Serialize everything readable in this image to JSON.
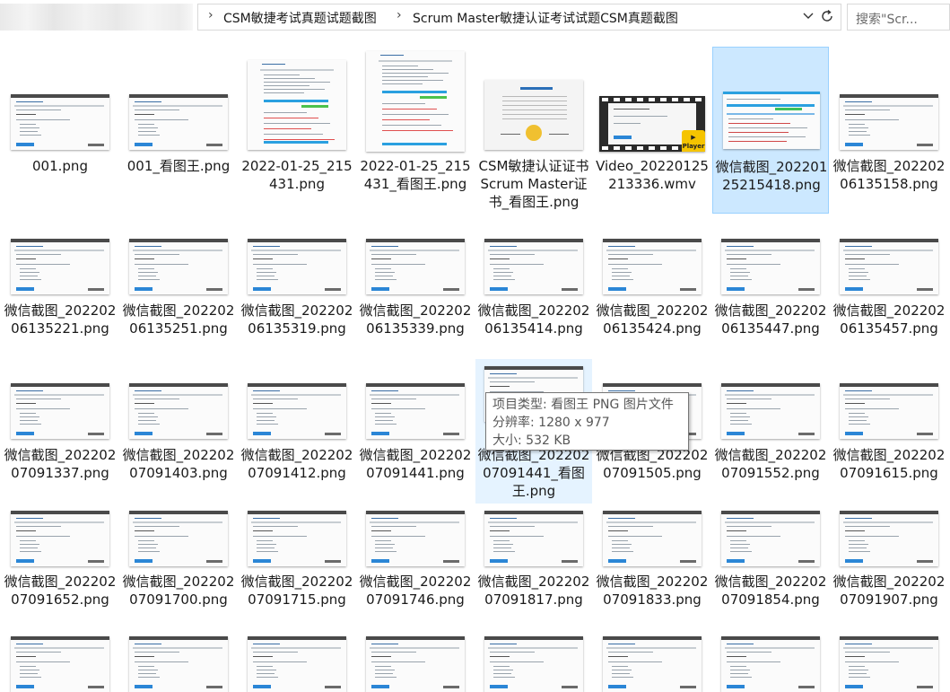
{
  "address_bar": {
    "breadcrumbs": [
      "CSM敏捷考试真题试题截图",
      "Scrum Master敏捷认证考试试题CSM真题截图"
    ]
  },
  "search": {
    "placeholder": "搜索\"Scr..."
  },
  "files": [
    {
      "name": "001.png",
      "kind": "screen"
    },
    {
      "name": "001_看图王.png",
      "kind": "screen"
    },
    {
      "name": "2022-01-25_215431.png",
      "kind": "doc"
    },
    {
      "name": "2022-01-25_215431_看图王.png",
      "kind": "doc"
    },
    {
      "name": "CSM敏捷认证证书 Scrum Master证书_看图王.png",
      "kind": "cert"
    },
    {
      "name": "Video_20220125213336.wmv",
      "kind": "video"
    },
    {
      "name": "微信截图_20220125215418.png",
      "kind": "wide",
      "selected": true
    },
    {
      "name": "微信截图_20220206135158.png",
      "kind": "screen"
    },
    {
      "name": "微信截图_20220206135221.png",
      "kind": "screen"
    },
    {
      "name": "微信截图_20220206135251.png",
      "kind": "screen"
    },
    {
      "name": "微信截图_20220206135319.png",
      "kind": "screen"
    },
    {
      "name": "微信截图_20220206135339.png",
      "kind": "screen"
    },
    {
      "name": "微信截图_20220206135414.png",
      "kind": "screen"
    },
    {
      "name": "微信截图_20220206135424.png",
      "kind": "screen"
    },
    {
      "name": "微信截图_20220206135447.png",
      "kind": "screen"
    },
    {
      "name": "微信截图_20220206135457.png",
      "kind": "screen"
    },
    {
      "name": "微信截图_20220207091337.png",
      "kind": "screen"
    },
    {
      "name": "微信截图_20220207091403.png",
      "kind": "screen"
    },
    {
      "name": "微信截图_20220207091412.png",
      "kind": "screen"
    },
    {
      "name": "微信截图_20220207091441.png",
      "kind": "screen"
    },
    {
      "name": "微信截图_20220207091441_看图王.png",
      "kind": "screen",
      "hover": true
    },
    {
      "name": "微信截图_20220207091505.png",
      "kind": "screen"
    },
    {
      "name": "微信截图_20220207091552.png",
      "kind": "screen"
    },
    {
      "name": "微信截图_20220207091615.png",
      "kind": "screen"
    },
    {
      "name": "微信截图_20220207091652.png",
      "kind": "screen"
    },
    {
      "name": "微信截图_20220207091700.png",
      "kind": "screen"
    },
    {
      "name": "微信截图_20220207091715.png",
      "kind": "screen"
    },
    {
      "name": "微信截图_20220207091746.png",
      "kind": "screen"
    },
    {
      "name": "微信截图_20220207091817.png",
      "kind": "screen"
    },
    {
      "name": "微信截图_20220207091833.png",
      "kind": "screen"
    },
    {
      "name": "微信截图_20220207091854.png",
      "kind": "screen"
    },
    {
      "name": "微信截图_20220207091907.png",
      "kind": "screen"
    },
    {
      "name": "",
      "kind": "screen"
    },
    {
      "name": "",
      "kind": "screen"
    },
    {
      "name": "",
      "kind": "screen"
    },
    {
      "name": "",
      "kind": "screen"
    },
    {
      "name": "",
      "kind": "screen"
    },
    {
      "name": "",
      "kind": "screen"
    },
    {
      "name": "",
      "kind": "screen"
    },
    {
      "name": "",
      "kind": "screen"
    }
  ],
  "tooltip": {
    "type_line": "项目类型: 看图王 PNG 图片文件",
    "resolution_line": "分辨率: 1280 x 977",
    "size_line": "大小: 532 KB"
  },
  "icons": {
    "dropdown": "chevron-down-icon",
    "refresh": "refresh-icon",
    "player_badge": "player-icon"
  },
  "colors": {
    "selection_bg": "#cce8ff",
    "selection_border": "#99d1ff",
    "hover_bg": "#e5f3ff",
    "player_badge": "#f5c400"
  }
}
